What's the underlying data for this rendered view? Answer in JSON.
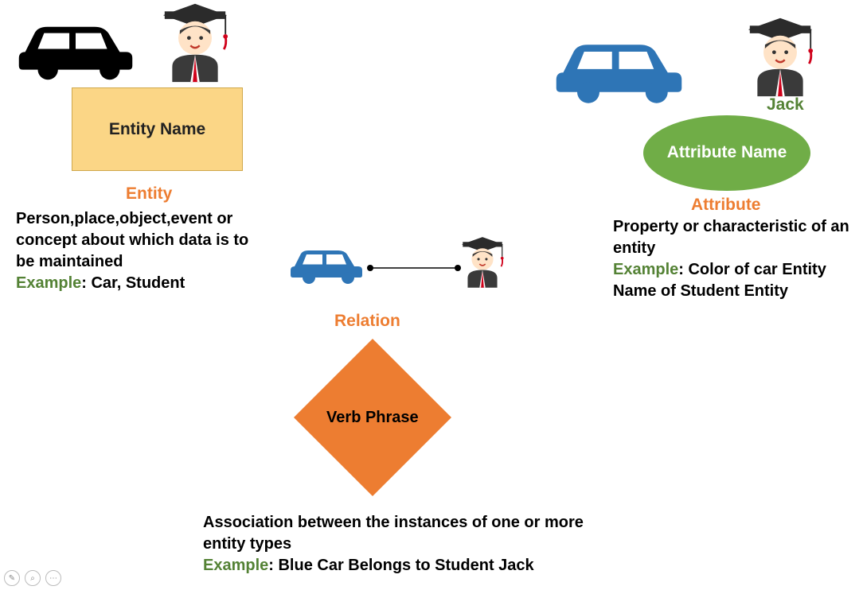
{
  "entity": {
    "box_label": "Entity Name",
    "heading": "Entity",
    "description": "Person,place,object,event or concept about which data is to be maintained",
    "example_label": "Example",
    "example_text": ": Car, Student"
  },
  "attribute": {
    "ellipse_label": "Attribute Name",
    "heading": "Attribute",
    "person_name": "Jack",
    "description": "Property or characteristic of an entity",
    "example_label": "Example",
    "example_text": ": Color of car Entity Name of Student Entity"
  },
  "relation": {
    "diamond_label": "Verb Phrase",
    "heading": "Relation",
    "description": "Association between the instances of one or more entity types",
    "example_label": "Example",
    "example_text": ": Blue Car Belongs to Student Jack"
  },
  "icons": {
    "car_black": "car-icon",
    "car_blue": "car-icon",
    "student": "student-icon"
  },
  "colors": {
    "orange": "#ed7d31",
    "green": "#70ad47",
    "green_text": "#548235",
    "entity_fill": "#fbd686",
    "car_blue": "#2e75b6"
  }
}
